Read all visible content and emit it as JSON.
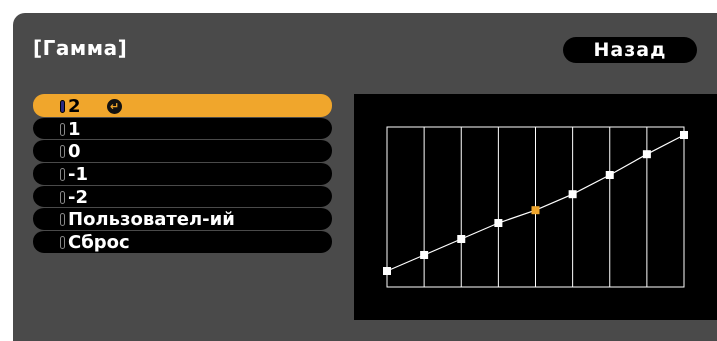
{
  "window": {
    "title": "[Гамма]"
  },
  "toolbar": {
    "back_label": "Назад"
  },
  "menu": {
    "items": [
      {
        "label": "2",
        "selected": true
      },
      {
        "label": "1",
        "selected": false
      },
      {
        "label": "0",
        "selected": false
      },
      {
        "label": "-1",
        "selected": false
      },
      {
        "label": "-2",
        "selected": false
      },
      {
        "label": "Пользовател-ий",
        "selected": false
      },
      {
        "label": "Сброс",
        "selected": false
      }
    ]
  },
  "icons": {
    "enter": "enter-icon"
  },
  "colors": {
    "accent": "#f0a62c",
    "background": "#4a4a4a",
    "panel": "#000000",
    "highlight_point": "#f0a62c"
  },
  "gamma_curve": {
    "points": [
      0.1,
      0.2,
      0.3,
      0.4,
      0.48,
      0.58,
      0.7,
      0.83,
      0.95
    ],
    "highlight_index": 4
  }
}
